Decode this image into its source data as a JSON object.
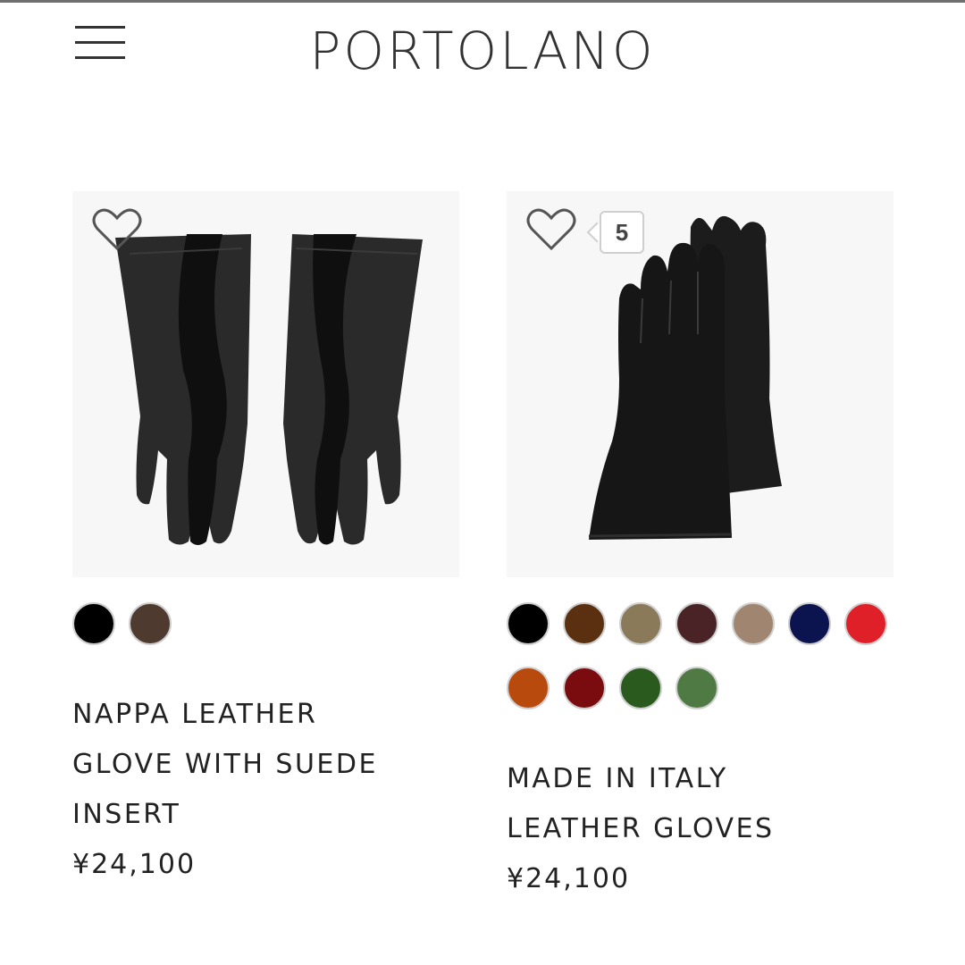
{
  "header": {
    "logo": "PORTOLANO",
    "menu_icon": "hamburger-menu-icon"
  },
  "products": [
    {
      "title_lines": [
        "NAPPA LEATHER",
        "GLOVE WITH SUEDE",
        "INSERT"
      ],
      "price": "¥24,100",
      "favorite_icon": "heart-outline-icon",
      "swatch_colors": [
        "#000000",
        "#4f3a30"
      ]
    },
    {
      "title_lines": [
        "MADE IN ITALY",
        "LEATHER GLOVES"
      ],
      "price": "¥24,100",
      "favorite_icon": "heart-outline-icon",
      "favorite_count": "5",
      "swatch_colors": [
        "#000000",
        "#5a3010",
        "#8b7a5a",
        "#4a2326",
        "#a08670",
        "#0c1450",
        "#e02028",
        "#b84a0e",
        "#7a0b0e",
        "#2a5a1e",
        "#4f7a44"
      ]
    }
  ]
}
